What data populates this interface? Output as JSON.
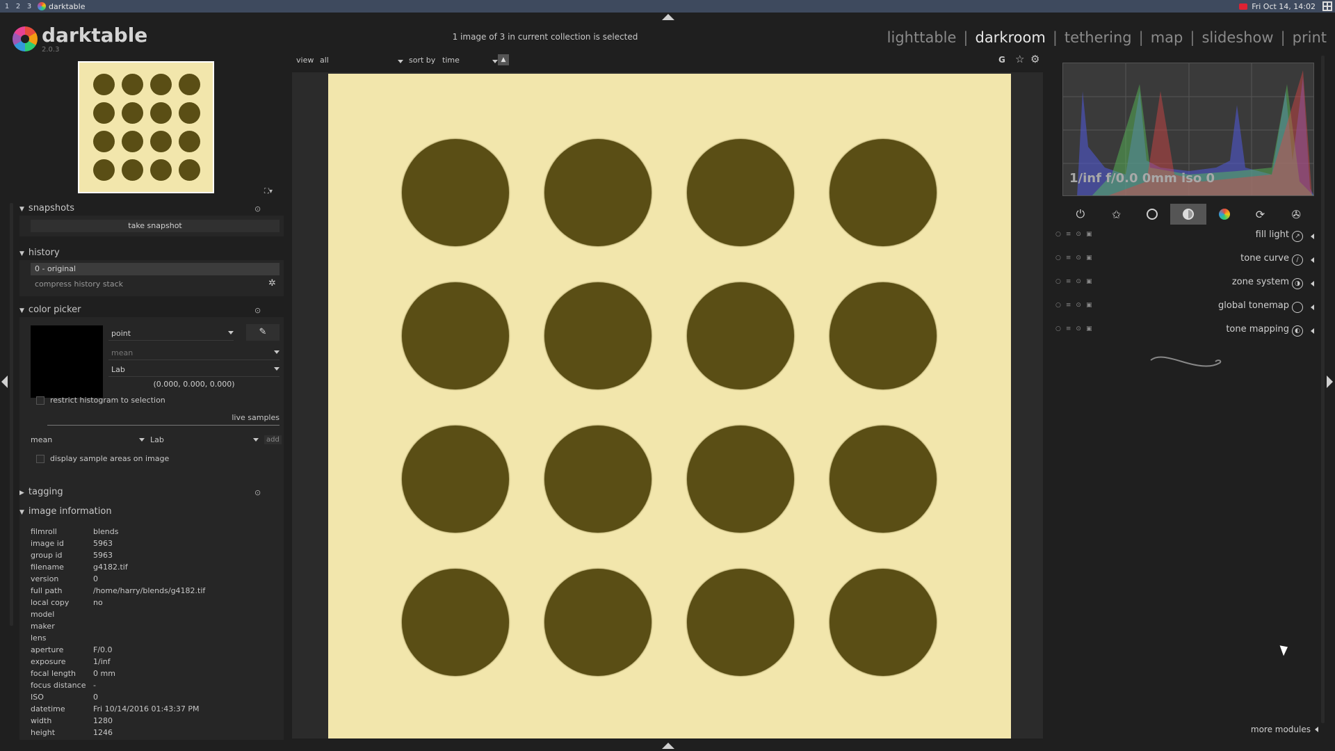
{
  "taskbar": {
    "workspaces": [
      "1",
      "2",
      "3"
    ],
    "app_title": "darktable",
    "clock": "Fri Oct 14, 14:02"
  },
  "header": {
    "brand": "darktable",
    "version": "2.0.3",
    "collection_status": "1 image of 3 in current collection is selected",
    "views": [
      "lighttable",
      "darkroom",
      "tethering",
      "map",
      "slideshow",
      "print"
    ],
    "active_view": "darkroom"
  },
  "filterbar": {
    "view_label": "view",
    "view_value": "all",
    "sort_label": "sort by",
    "sort_value": "time",
    "sort_dir": "▲",
    "grouping": "G"
  },
  "left": {
    "snapshots": {
      "title": "snapshots",
      "take_snapshot": "take snapshot"
    },
    "history": {
      "title": "history",
      "items": [
        "0 - original"
      ],
      "compress": "compress history stack"
    },
    "color_picker": {
      "title": "color picker",
      "mode": "point",
      "stat": "mean",
      "colorspace": "Lab",
      "values": "(0.000, 0.000, 0.000)",
      "restrict_label": "restrict histogram to selection",
      "live_samples": "live samples",
      "sample_stat": "mean",
      "sample_space": "Lab",
      "add": "add",
      "display_label": "display sample areas on image"
    },
    "tagging": {
      "title": "tagging"
    },
    "image_information": {
      "title": "image information",
      "rows": [
        {
          "k": "filmroll",
          "v": "blends"
        },
        {
          "k": "image id",
          "v": "5963"
        },
        {
          "k": "group id",
          "v": "5963"
        },
        {
          "k": "filename",
          "v": "g4182.tif"
        },
        {
          "k": "version",
          "v": "0"
        },
        {
          "k": "full path",
          "v": "/home/harry/blends/g4182.tif"
        },
        {
          "k": "local copy",
          "v": "no"
        },
        {
          "k": "model",
          "v": ""
        },
        {
          "k": "maker",
          "v": ""
        },
        {
          "k": "lens",
          "v": ""
        },
        {
          "k": "aperture",
          "v": "F/0.0"
        },
        {
          "k": "exposure",
          "v": "1/inf"
        },
        {
          "k": "focal length",
          "v": "0 mm"
        },
        {
          "k": "focus distance",
          "v": "-"
        },
        {
          "k": "ISO",
          "v": "0"
        },
        {
          "k": "datetime",
          "v": "Fri 10/14/2016 01:43:37 PM"
        },
        {
          "k": "width",
          "v": "1280"
        },
        {
          "k": "height",
          "v": "1246"
        }
      ]
    }
  },
  "right": {
    "exif_line": "1/inf f/0.0 0mm iso 0",
    "module_groups": [
      "power-icon",
      "star-icon",
      "circle-icon",
      "half-circle-icon",
      "color-icon",
      "rotate-icon",
      "aperture-icon"
    ],
    "active_group": 3,
    "modules": [
      "fill light",
      "tone curve",
      "zone system",
      "global tonemap",
      "tone mapping"
    ],
    "more_modules": "more modules"
  },
  "colors": {
    "image_bg": "#f2e6ac",
    "dot": "#5a4e15",
    "panel_bg": "#1f1f1f"
  }
}
